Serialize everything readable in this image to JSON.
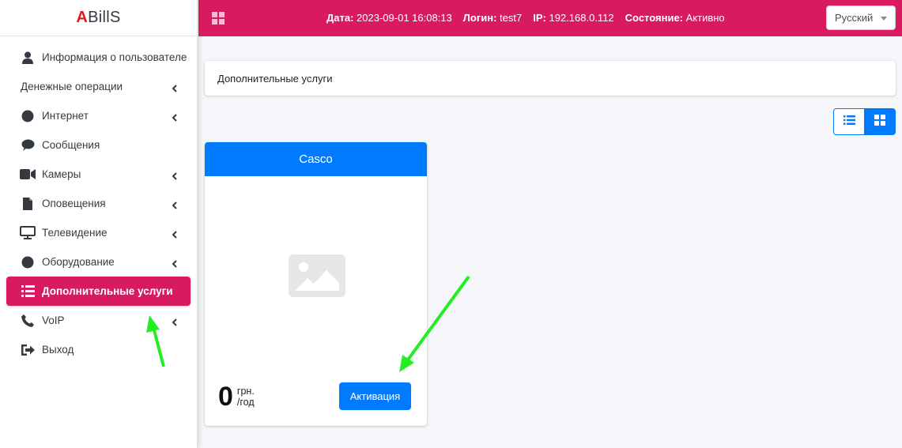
{
  "brand": {
    "accent_letter": "A",
    "rest": "BillS"
  },
  "sidebar": {
    "items": [
      {
        "label": "Информация о пользователе",
        "icon": "user-icon",
        "has_chevron": false
      },
      {
        "label": "Денежные операции",
        "icon": "",
        "has_chevron": true
      },
      {
        "label": "Интернет",
        "icon": "globe-icon",
        "has_chevron": true
      },
      {
        "label": "Сообщения",
        "icon": "comment-icon",
        "has_chevron": false
      },
      {
        "label": "Камеры",
        "icon": "video-camera-icon",
        "has_chevron": true
      },
      {
        "label": "Оповещения",
        "icon": "file-icon",
        "has_chevron": true
      },
      {
        "label": "Телевидение",
        "icon": "tv-icon",
        "has_chevron": true
      },
      {
        "label": "Оборудование",
        "icon": "circle-icon",
        "has_chevron": true
      },
      {
        "label": "Дополнительные услуги",
        "icon": "list-icon",
        "has_chevron": false,
        "active": true
      },
      {
        "label": "VoIP",
        "icon": "phone-icon",
        "has_chevron": true
      },
      {
        "label": "Выход",
        "icon": "sign-out-icon",
        "has_chevron": false
      }
    ]
  },
  "topbar": {
    "date_label": "Дата:",
    "date_value": "2023-09-01 16:08:13",
    "login_label": "Логин:",
    "login_value": "test7",
    "ip_label": "IP:",
    "ip_value": "192.168.0.112",
    "status_label": "Состояние:",
    "status_value": "Активно",
    "language": "Русский"
  },
  "main": {
    "page_title": "Дополнительные услуги",
    "service": {
      "name": "Casco",
      "price": "0",
      "currency": "грн.",
      "period": "/год",
      "button_label": "Активация"
    }
  },
  "colors": {
    "primary": "#007bff",
    "accent": "#d81b60",
    "brand_red": "#dc1c1c",
    "annotation_arrow": "#22ee22"
  }
}
